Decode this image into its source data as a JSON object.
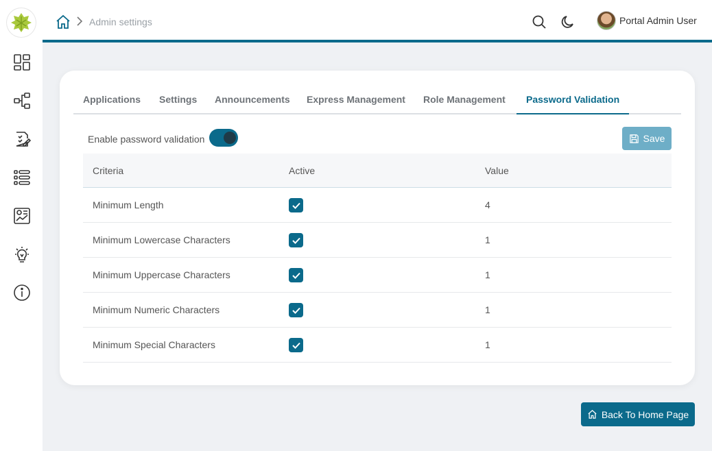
{
  "breadcrumb": {
    "current": "Admin settings"
  },
  "header": {
    "user_name": "Portal Admin User"
  },
  "sidebar": {
    "icons": [
      "dashboard-icon",
      "workflow-icon",
      "tasks-icon",
      "list-icon",
      "reports-icon",
      "ideas-icon",
      "info-icon"
    ]
  },
  "tabs": [
    {
      "label": "Applications"
    },
    {
      "label": "Settings"
    },
    {
      "label": "Announcements"
    },
    {
      "label": "Express Management"
    },
    {
      "label": "Role Management"
    },
    {
      "label": "Password Validation",
      "active": true
    }
  ],
  "password_validation": {
    "enable_label": "Enable password validation",
    "enabled": true,
    "save_label": "Save"
  },
  "table": {
    "headers": [
      "Criteria",
      "Active",
      "Value"
    ],
    "rows": [
      {
        "criteria": "Minimum Length",
        "active": true,
        "value": "4"
      },
      {
        "criteria": "Minimum Lowercase Characters",
        "active": true,
        "value": "1"
      },
      {
        "criteria": "Minimum Uppercase Characters",
        "active": true,
        "value": "1"
      },
      {
        "criteria": "Minimum Numeric Characters",
        "active": true,
        "value": "1"
      },
      {
        "criteria": "Minimum Special Characters",
        "active": true,
        "value": "1"
      }
    ]
  },
  "footer": {
    "back_label": "Back To Home Page"
  },
  "colors": {
    "accent": "#0b6a8b",
    "save_disabled": "#6eaec7",
    "page_bg": "#eff1f4"
  }
}
